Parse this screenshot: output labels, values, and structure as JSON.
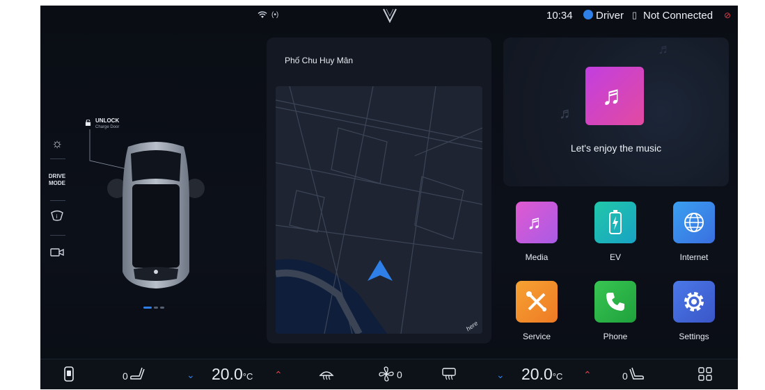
{
  "status_bar": {
    "wifi_icon": "wifi-icon",
    "hotspot_label": "(•)",
    "time": "10:34",
    "driver": "Driver",
    "connection": "Not Connected"
  },
  "vehicle": {
    "unlock_label": "UNLOCK",
    "unlock_sub": "Charge Door",
    "drive_mode_line1": "DRIVE",
    "drive_mode_line2": "MODE"
  },
  "map": {
    "street": "Phố Chu Huy Mân",
    "provider": "here"
  },
  "music": {
    "tagline": "Let's enjoy the music"
  },
  "apps": [
    {
      "label": "Media",
      "icon": "music-note-icon",
      "color": "#d44fd6"
    },
    {
      "label": "EV",
      "icon": "battery-charge-icon",
      "color": "#19b6a5"
    },
    {
      "label": "Internet",
      "icon": "globe-icon",
      "color": "#2f8fe8"
    },
    {
      "label": "Service",
      "icon": "tools-icon",
      "color": "#f08a2a"
    },
    {
      "label": "Phone",
      "icon": "phone-icon",
      "color": "#27b34a"
    },
    {
      "label": "Settings",
      "icon": "gear-icon",
      "color": "#3f6fe0"
    }
  ],
  "climate": {
    "left_seat_heat": "0",
    "left_temp": "20.0",
    "temp_unit": "°C",
    "fan_speed": "0",
    "right_temp": "20.0",
    "right_seat_heat": "0"
  },
  "colors": {
    "accent_blue": "#2f7fe8",
    "alert_red": "#e0414b",
    "background": "#0a0d14"
  }
}
